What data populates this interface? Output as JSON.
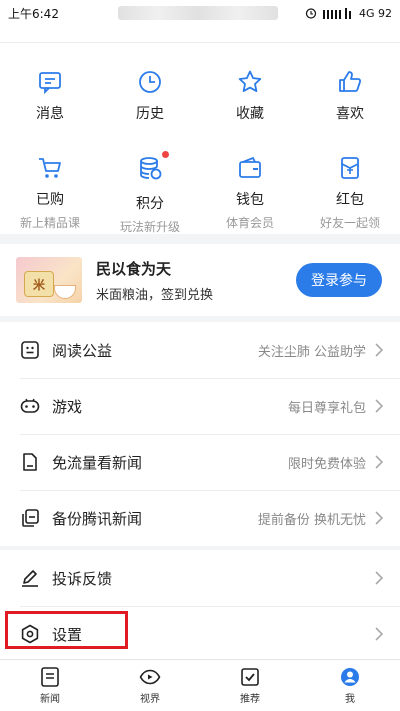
{
  "status": {
    "time": "上午6:42",
    "right": "4G 92"
  },
  "grid": [
    {
      "label": "消息",
      "icon": "message-icon"
    },
    {
      "label": "历史",
      "icon": "clock-icon"
    },
    {
      "label": "收藏",
      "icon": "star-icon"
    },
    {
      "label": "喜欢",
      "icon": "thumbs-up-icon"
    },
    {
      "label": "已购",
      "sub": "新上精品课",
      "icon": "cart-icon"
    },
    {
      "label": "积分",
      "sub": "玩法新升级",
      "icon": "coins-icon"
    },
    {
      "label": "钱包",
      "sub": "体育会员",
      "icon": "wallet-icon"
    },
    {
      "label": "红包",
      "sub": "好友一起领",
      "icon": "red-packet-icon"
    }
  ],
  "promo": {
    "title": "民以食为天",
    "subtitle": "米面粮油，签到兑换",
    "image_text": "米",
    "button": "登录参与"
  },
  "list1": [
    {
      "label": "阅读公益",
      "hint": "关注尘肺 公益助学",
      "icon": "charity-icon"
    },
    {
      "label": "游戏",
      "hint": "每日尊享礼包",
      "icon": "gamepad-icon"
    },
    {
      "label": "免流量看新闻",
      "hint": "限时免费体验",
      "icon": "data-free-icon"
    },
    {
      "label": "备份腾讯新闻",
      "hint": "提前备份 换机无忧",
      "icon": "backup-icon"
    }
  ],
  "list2": [
    {
      "label": "投诉反馈",
      "icon": "pencil-icon"
    },
    {
      "label": "设置",
      "icon": "settings-icon"
    }
  ],
  "tabs": [
    {
      "label": "新闻",
      "icon": "news-icon"
    },
    {
      "label": "视界",
      "icon": "eye-icon"
    },
    {
      "label": "推荐",
      "icon": "recommend-icon"
    },
    {
      "label": "我",
      "icon": "me-icon"
    }
  ],
  "colors": {
    "accent": "#2b7ce9",
    "highlight": "#e01b24",
    "red_dot": "#ee4444"
  }
}
